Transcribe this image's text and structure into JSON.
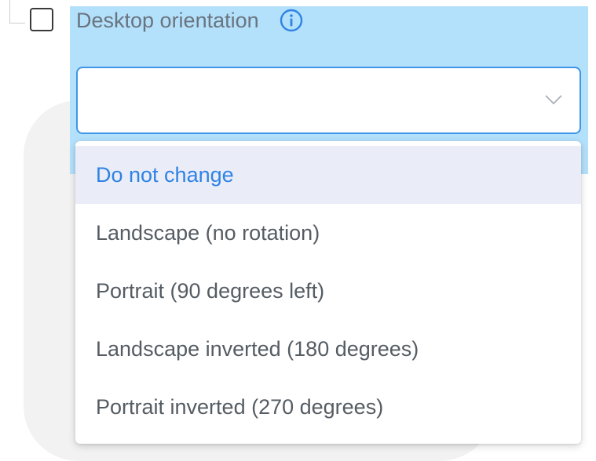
{
  "setting": {
    "label": "Desktop orientation",
    "info_icon": "info-circle-icon",
    "checked": false
  },
  "select": {
    "value": "",
    "chevron_icon": "chevron-down-icon"
  },
  "dropdown": {
    "options": [
      {
        "label": "Do not change",
        "selected": true
      },
      {
        "label": "Landscape (no rotation)",
        "selected": false
      },
      {
        "label": "Portrait (90 degrees left)",
        "selected": false
      },
      {
        "label": "Landscape inverted (180 degrees)",
        "selected": false
      },
      {
        "label": "Portrait inverted (270 degrees)",
        "selected": false
      }
    ]
  },
  "colors": {
    "highlight": "#b3e0fb",
    "accent": "#2f83e4",
    "selected_bg": "#eaedf8",
    "text": "#555c63",
    "label": "#6a747f"
  }
}
